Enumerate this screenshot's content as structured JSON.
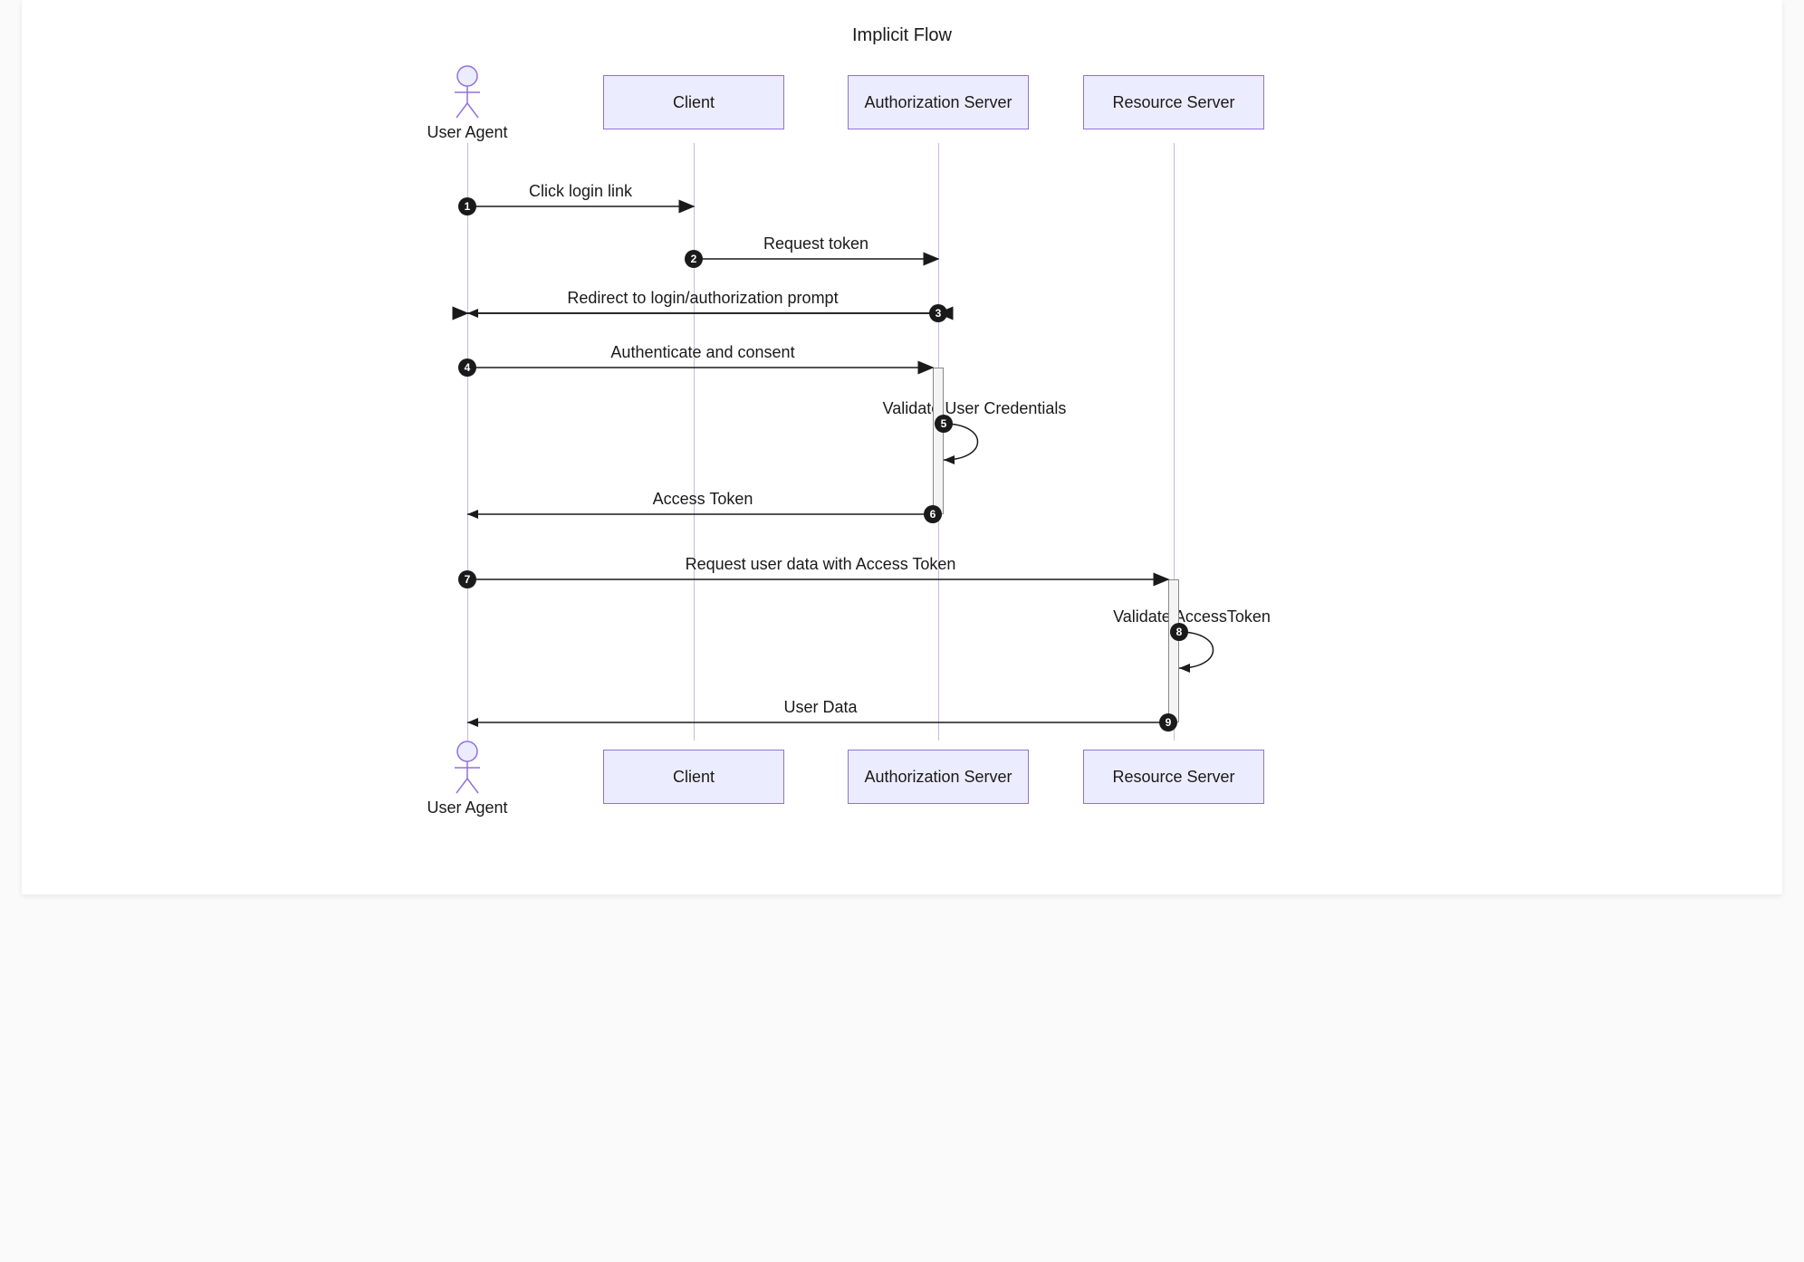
{
  "title": "Implicit Flow",
  "participants": {
    "userAgent": "User Agent",
    "client": "Client",
    "authServer": "Authorization Server",
    "resourceServer": "Resource Server"
  },
  "messages": {
    "m1": "Click login link",
    "m2": "Request token",
    "m3": "Redirect to login/authorization prompt",
    "m4": "Authenticate and consent",
    "m5": "Validate User Credentials",
    "m6": "Access Token",
    "m7": "Request user data with Access Token",
    "m8": "Validate AccessToken",
    "m9": "User Data"
  },
  "layout": {
    "x": {
      "userAgent": 120,
      "client": 370,
      "authServer": 640,
      "resourceServer": 900
    },
    "y": {
      "m1": 200,
      "m2": 258,
      "m3": 318,
      "m4": 378,
      "m5": 440,
      "m6": 540,
      "m7": 612,
      "m8": 670,
      "m9": 770
    },
    "topBoxesY": 55,
    "bottomBoxesY": 800,
    "actorTopY": 44,
    "actorBottomY": 790
  }
}
